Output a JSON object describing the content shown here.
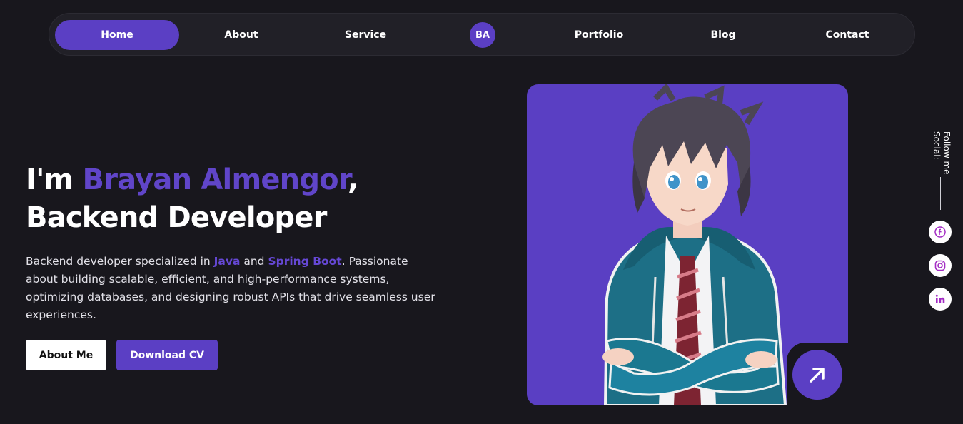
{
  "nav": {
    "items": [
      {
        "label": "Home",
        "active": true
      },
      {
        "label": "About",
        "active": false
      },
      {
        "label": "Service",
        "active": false
      },
      {
        "label": "Portfolio",
        "active": false
      },
      {
        "label": "Blog",
        "active": false
      },
      {
        "label": "Contact",
        "active": false
      }
    ],
    "logo": "BA"
  },
  "hero": {
    "intro": "I'm ",
    "name": "Brayan Almengor",
    "comma": ",",
    "role": "Backend Developer",
    "desc_1": "Backend developer specialized in ",
    "desc_java": "Java",
    "desc_and": " and ",
    "desc_spring": "Spring Boot",
    "desc_2": ". Passionate about building scalable, efficient, and high-performance systems, optimizing databases, and designing robust APIs that drive seamless user experiences.",
    "about_button": "About Me",
    "cv_button": "Download CV"
  },
  "social": {
    "follow_label": "Follow me\nSocial:",
    "icons": [
      "facebook-icon",
      "instagram-icon",
      "linkedin-icon"
    ]
  },
  "colors": {
    "accent": "#5b3fc4",
    "background": "#18171d",
    "nav_bg": "#212027",
    "social_icon": "#a32cc4"
  }
}
